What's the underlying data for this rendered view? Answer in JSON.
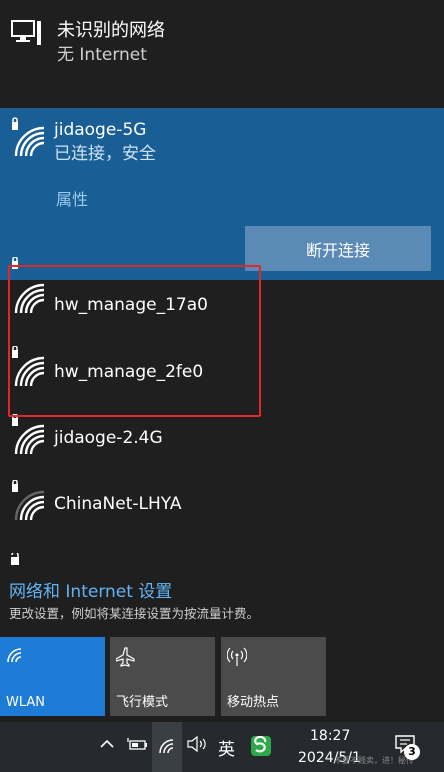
{
  "header": {
    "title": "未识别的网络",
    "subtitle": "无 Internet",
    "icon": "computer-network-icon"
  },
  "connected": {
    "name": "jidaoge-5G",
    "status": "已连接，安全",
    "properties_label": "属性",
    "disconnect_label": "断开连接"
  },
  "networks": [
    {
      "name": "hw_manage_17a0"
    },
    {
      "name": "hw_manage_2fe0"
    },
    {
      "name": "jidaoge-2.4G"
    },
    {
      "name": "ChinaNet-LHYA"
    }
  ],
  "settings": {
    "title": "网络和 Internet 设置",
    "description": "更改设置，例如将某连接设置为按流量计费。"
  },
  "tiles": [
    {
      "label": "WLAN",
      "icon": "wifi-icon",
      "active": true
    },
    {
      "label": "飞行模式",
      "icon": "airplane-icon",
      "active": false
    },
    {
      "label": "移动热点",
      "icon": "hotspot-icon",
      "active": false
    }
  ],
  "taskbar": {
    "ime": "英",
    "time": "18:27",
    "date": "2024/5/1",
    "watermark": "不要不贱卖，进！秘传",
    "notifications": "3"
  },
  "colors": {
    "connected_bg": "#1a5e96",
    "accent": "#1e7bd6",
    "link": "#62b4f5",
    "highlight_box": "#e02828"
  }
}
